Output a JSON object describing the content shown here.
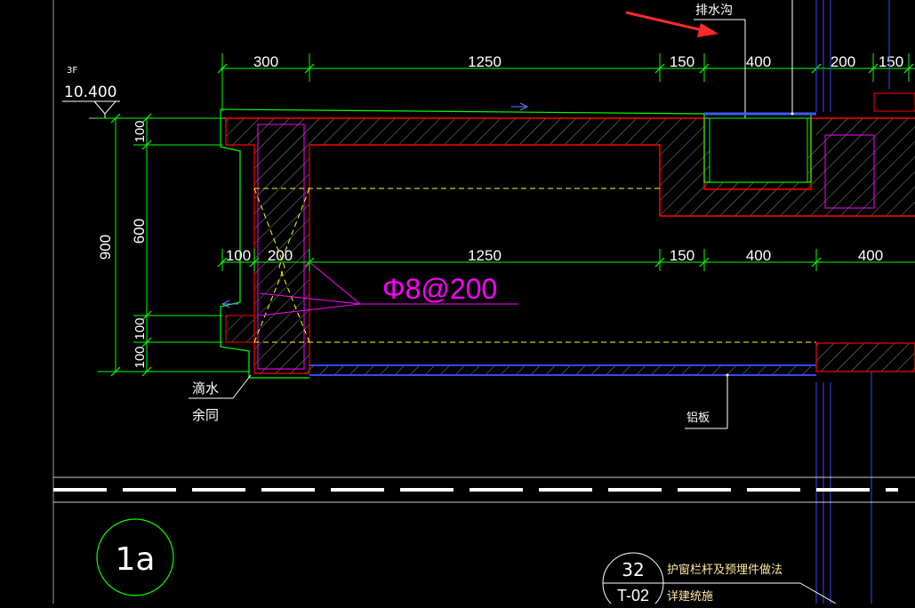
{
  "drawing": {
    "level": {
      "floor": "3F",
      "elevation": "10.400"
    },
    "top_dims": [
      "300",
      "1250",
      "150",
      "400",
      "200",
      "150"
    ],
    "mid_dims": [
      "100",
      "200",
      "1250",
      "150",
      "400",
      "400"
    ],
    "left_dims": {
      "total": "900",
      "top": "100",
      "middle": "600",
      "lower1": "100",
      "lower2": "100"
    },
    "rebar": "Φ8@200",
    "labels": {
      "drain_channel": "排水沟",
      "drip": "滴水",
      "rest_same": "余同",
      "aluminum_plate": "铝板",
      "section_id": "1a",
      "detail_number": "32",
      "detail_sheet": "T-02",
      "note_line1": "护窗栏杆及预埋件做法",
      "note_line2": "详建统施"
    },
    "colors": {
      "background": "#000000",
      "dimension": "#00ff00",
      "concrete_outline": "#ff0000",
      "rebar_leader": "#ff00ff",
      "hidden_rebar": "#ffff00",
      "aluminum": "#0000ff",
      "text": "#ffffff",
      "arrow": "#ff2a2a"
    }
  }
}
